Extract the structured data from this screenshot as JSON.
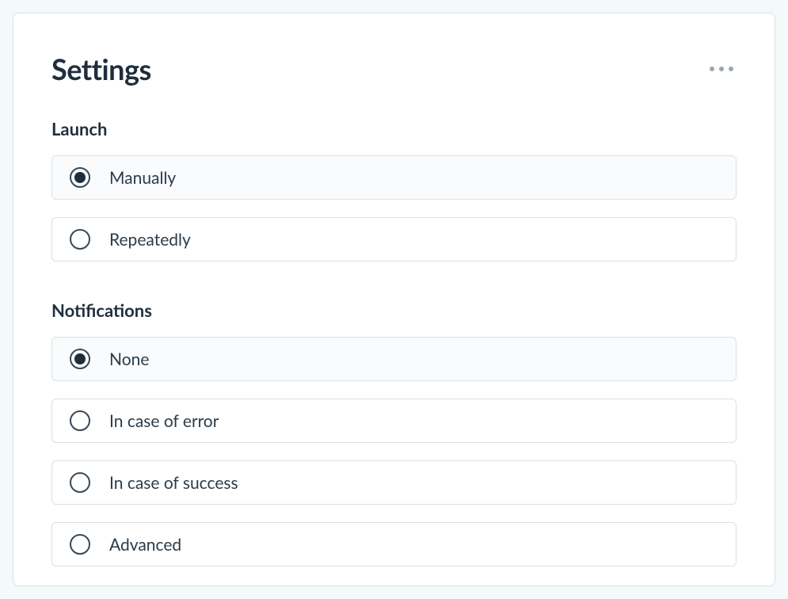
{
  "title": "Settings",
  "sections": {
    "launch": {
      "heading": "Launch",
      "options": [
        {
          "label": "Manually",
          "selected": true
        },
        {
          "label": "Repeatedly",
          "selected": false
        }
      ]
    },
    "notifications": {
      "heading": "Notifications",
      "options": [
        {
          "label": "None",
          "selected": true
        },
        {
          "label": "In case of error",
          "selected": false
        },
        {
          "label": "In case of success",
          "selected": false
        },
        {
          "label": "Advanced",
          "selected": false
        }
      ]
    }
  }
}
